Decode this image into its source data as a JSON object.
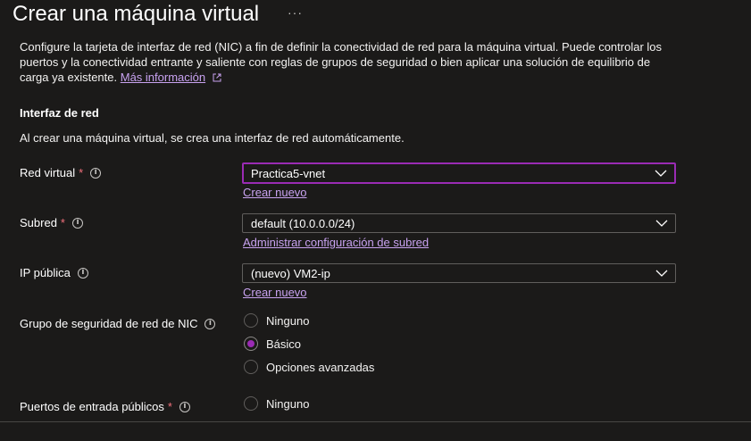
{
  "header": {
    "title": "Crear una máquina virtual",
    "more_label": "···"
  },
  "intro": {
    "text": "Configure la tarjeta de interfaz de red (NIC) a fin de definir la conectividad de red para la máquina virtual. Puede controlar los puertos y la conectividad entrante y saliente con reglas de grupos de seguridad o bien aplicar una solución de equilibrio de carga ya existente.",
    "link": "Más información"
  },
  "section": {
    "title": "Interfaz de red",
    "description": "Al crear una máquina virtual, se crea una interfaz de red automáticamente."
  },
  "fields": {
    "vnet": {
      "label": "Red virtual",
      "required": "*",
      "value": "Practica5-vnet",
      "link": "Crear nuevo"
    },
    "subnet": {
      "label": "Subred",
      "required": "*",
      "value": "default (10.0.0.0/24)",
      "link": "Administrar configuración de subred"
    },
    "public_ip": {
      "label": "IP pública",
      "value": "(nuevo) VM2-ip",
      "link": "Crear nuevo"
    },
    "nsg": {
      "label": "Grupo de seguridad de red de NIC",
      "options": [
        "Ninguno",
        "Básico",
        "Opciones avanzadas"
      ],
      "selected": "Básico"
    },
    "inbound_ports": {
      "label": "Puertos de entrada públicos",
      "required": "*",
      "options": [
        "Ninguno"
      ]
    }
  },
  "colors": {
    "background": "#1b1a19",
    "accent": "#9a2bb4",
    "link": "#c8a2f0",
    "required": "#f1707b"
  }
}
